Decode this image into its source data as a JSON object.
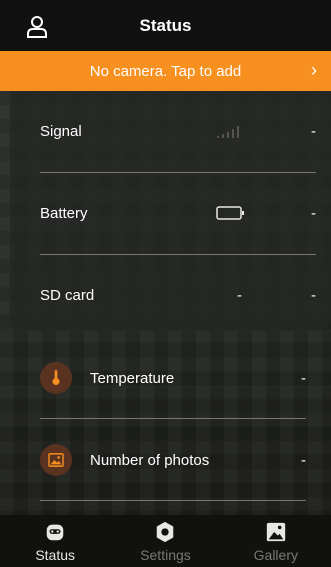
{
  "header": {
    "title": "Status",
    "user_icon": "user-icon"
  },
  "banner": {
    "text": "No camera. Tap to add",
    "chevron": "›"
  },
  "status_items": [
    {
      "label": "Signal",
      "value": "-",
      "icon": "signal-bars-icon"
    },
    {
      "label": "Battery",
      "value": "-",
      "icon": "battery-icon"
    },
    {
      "label": "SD card",
      "value": "-",
      "extra": "-"
    }
  ],
  "lower_items": [
    {
      "label": "Temperature",
      "value": "-",
      "icon": "thermometer-icon"
    },
    {
      "label": "Number of photos",
      "value": "-",
      "icon": "photo-icon"
    }
  ],
  "tabs": [
    {
      "label": "Status",
      "icon": "camera-robot-icon",
      "active": true
    },
    {
      "label": "Settings",
      "icon": "gear-icon",
      "active": false
    },
    {
      "label": "Gallery",
      "icon": "gallery-icon",
      "active": false
    }
  ],
  "colors": {
    "accent": "#f7901e",
    "icon_bg": "#5a3320",
    "inactive_tab": "#77796f"
  }
}
